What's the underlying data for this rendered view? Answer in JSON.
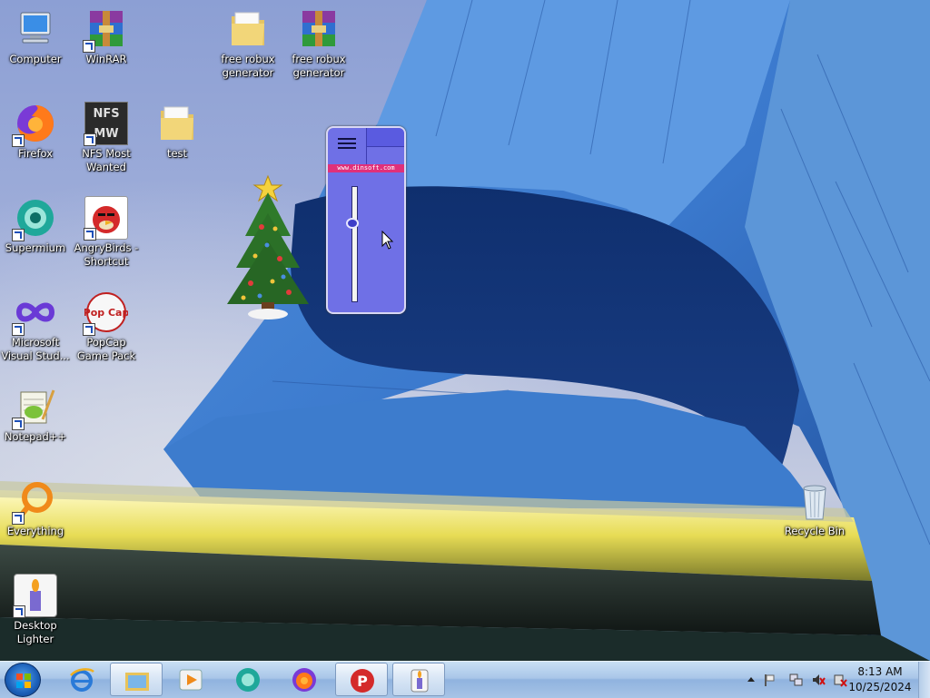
{
  "desktop_icons": [
    {
      "id": "computer",
      "label": "Computer"
    },
    {
      "id": "winrar",
      "label": "WinRAR"
    },
    {
      "id": "robux1",
      "label": "free robux generator"
    },
    {
      "id": "robux2",
      "label": "free robux generator"
    },
    {
      "id": "firefox",
      "label": "Firefox"
    },
    {
      "id": "nfs",
      "label": "NFS Most Wanted"
    },
    {
      "id": "test",
      "label": "test"
    },
    {
      "id": "supermium",
      "label": "Supermium"
    },
    {
      "id": "angrybirds",
      "label": "AngryBirds - Shortcut"
    },
    {
      "id": "vstudio",
      "label": "Microsoft Visual Stud..."
    },
    {
      "id": "popcap",
      "label": "PopCap Game Pack"
    },
    {
      "id": "notepadpp",
      "label": "Notepad++"
    },
    {
      "id": "everything",
      "label": "Everything"
    },
    {
      "id": "lighter",
      "label": "Desktop Lighter"
    },
    {
      "id": "recycle",
      "label": "Recycle Bin"
    }
  ],
  "gadget": {
    "url": "www.dinsoft.com",
    "brightness_level": 0.32
  },
  "icon_texts": {
    "nfs_art": "NFS MW",
    "popcap_art": "Pop Cap",
    "pin_letter": "P"
  },
  "taskbar": {
    "items": [
      {
        "name": "Internet Explorer"
      },
      {
        "name": "Windows Explorer"
      },
      {
        "name": "Windows Media Player"
      },
      {
        "name": "Supermium"
      },
      {
        "name": "Firefox"
      },
      {
        "name": "Psiphon"
      },
      {
        "name": "Desktop Lighter"
      }
    ],
    "clock": {
      "time": "8:13 AM",
      "date": "10/25/2024"
    }
  },
  "colors": {
    "gadget": "#6f70e6",
    "gadget_url_bar": "#e0307a",
    "taskbar": "#a9c6e8"
  }
}
